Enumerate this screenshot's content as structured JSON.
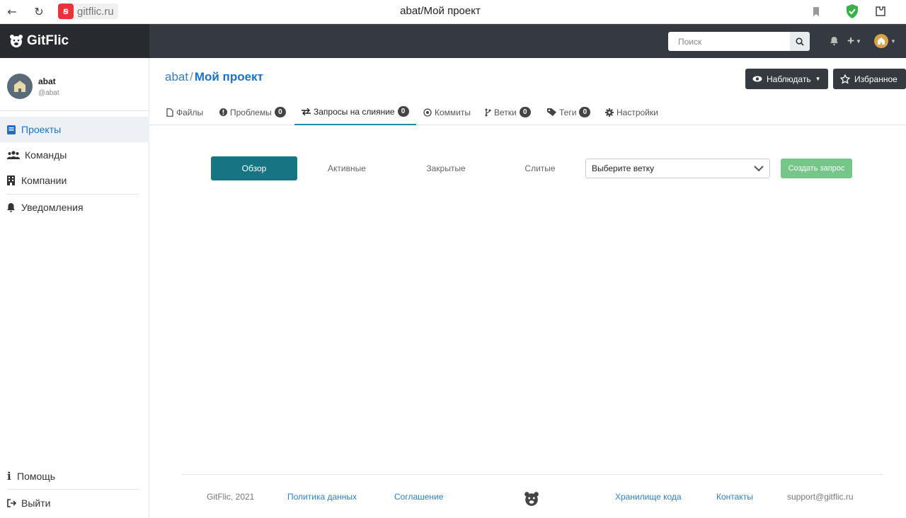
{
  "browser": {
    "host": "gitflic.ru",
    "tab_title": "abat/Мой проект"
  },
  "topnav": {
    "brand": "GitFlic",
    "search_placeholder": "Поиск"
  },
  "sidebar": {
    "user": {
      "name": "abat",
      "handle": "@abat"
    },
    "items": [
      {
        "label": "Проекты",
        "icon": "book-icon",
        "active": true
      },
      {
        "label": "Команды",
        "icon": "users-icon",
        "active": false
      },
      {
        "label": "Компании",
        "icon": "building-icon",
        "active": false
      },
      {
        "label": "Уведомления",
        "icon": "bell-icon",
        "active": false
      }
    ],
    "bottom": [
      {
        "label": "Помощь",
        "icon": "info-icon"
      },
      {
        "label": "Выйти",
        "icon": "logout-icon"
      }
    ]
  },
  "header": {
    "owner": "abat",
    "separator": "/",
    "project": "Мой проект",
    "watch_label": "Наблюдать",
    "favorite_label": "Избранное"
  },
  "tabs": [
    {
      "label": "Файлы",
      "icon": "file-icon"
    },
    {
      "label": "Проблемы",
      "icon": "exclamation-circle-icon",
      "badge": "0"
    },
    {
      "label": "Запросы на слияние",
      "icon": "exchange-icon",
      "badge": "0",
      "active": true
    },
    {
      "label": "Коммиты",
      "icon": "commit-icon"
    },
    {
      "label": "Ветки",
      "icon": "branch-icon",
      "badge": "0"
    },
    {
      "label": "Теги",
      "icon": "tag-icon",
      "badge": "0"
    },
    {
      "label": "Настройки",
      "icon": "gear-icon"
    }
  ],
  "filters": [
    {
      "label": "Обзор",
      "active": true
    },
    {
      "label": "Активные"
    },
    {
      "label": "Закрытые"
    },
    {
      "label": "Слитые"
    }
  ],
  "branch_select": {
    "value": "Выберите ветку"
  },
  "create_button": "Создать запрос",
  "footer": {
    "copyright": "GitFlic, 2021",
    "privacy": "Политика данных",
    "agreement": "Соглашение",
    "storage": "Хранилище кода",
    "contacts": "Контакты",
    "email": "support@gitflic.ru"
  },
  "colors": {
    "navbar": "#343a40",
    "accent": "#167483",
    "link": "#1a73c9",
    "create": "#74c788"
  }
}
